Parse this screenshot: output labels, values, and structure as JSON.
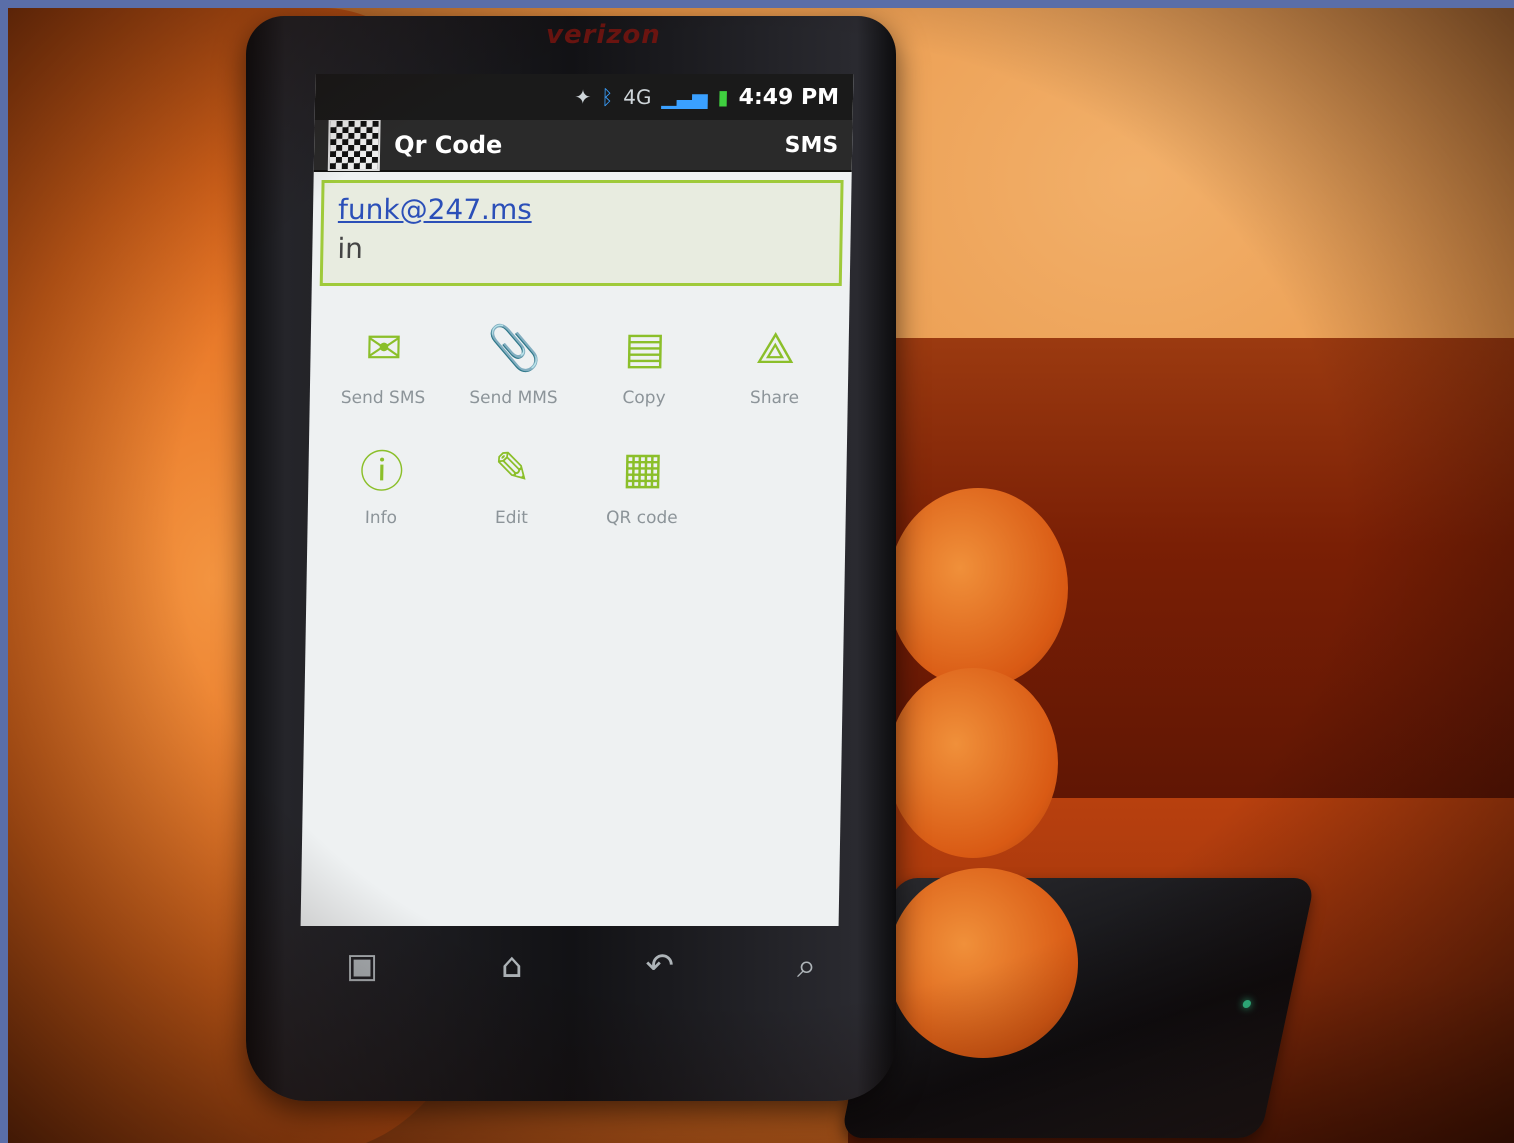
{
  "device": {
    "carrier": "verizon"
  },
  "statusbar": {
    "network": "4G",
    "time": "4:49 PM"
  },
  "titlebar": {
    "title": "Qr Code",
    "type": "SMS"
  },
  "content": {
    "email": "funk@247.ms",
    "message": "in"
  },
  "actions": [
    {
      "label": "Send SMS",
      "icon": "send-sms-icon"
    },
    {
      "label": "Send MMS",
      "icon": "send-mms-icon"
    },
    {
      "label": "Copy",
      "icon": "copy-icon"
    },
    {
      "label": "Share",
      "icon": "share-icon"
    },
    {
      "label": "Info",
      "icon": "info-icon"
    },
    {
      "label": "Edit",
      "icon": "edit-icon"
    },
    {
      "label": "QR code",
      "icon": "qr-code-icon"
    }
  ],
  "navbar": [
    "menu",
    "home",
    "back",
    "search"
  ]
}
